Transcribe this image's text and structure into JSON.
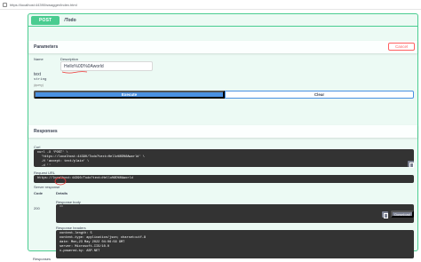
{
  "browser": {
    "url": "https://localhost:44390/swagger/index.html"
  },
  "operation": {
    "method": "POST",
    "path": "/Todo"
  },
  "parameters": {
    "title": "Parameters",
    "cancel_label": "Cancel",
    "col_name": "Name",
    "col_description": "Description",
    "param": {
      "name": "text",
      "type": "string",
      "in": "(query)",
      "value": "Hello%0D%0Aworld"
    }
  },
  "actions": {
    "execute_label": "Execute",
    "clear_label": "Clear"
  },
  "responses": {
    "title": "Responses",
    "curl_label": "Curl",
    "curl_code": "curl -X 'POST' \\\n  'https://localhost:44390/Todo?text=Hello%0D%0Aworld' \\\n  -H 'accept: text/plain' \\\n  -d ''",
    "request_url_label": "Request URL",
    "request_url": "https://localhost:44390/Todo?text=Hello%0D%0Aworld",
    "server_response_label": "Server response",
    "col_code": "Code",
    "col_details": "Details",
    "code": "200",
    "body_label": "Response body",
    "body": "\"\"",
    "download_label": "Download",
    "headers_label": "Response headers",
    "headers_code": "content-length: 5\ncontent-type: application/json; charset=utf-8\ndate: Mon,23 May 2022 04:06:56 GMT\nserver: Microsoft-IIS/10.0\nx-powered-by: ASP.NET",
    "bottom_label": "Responses"
  }
}
